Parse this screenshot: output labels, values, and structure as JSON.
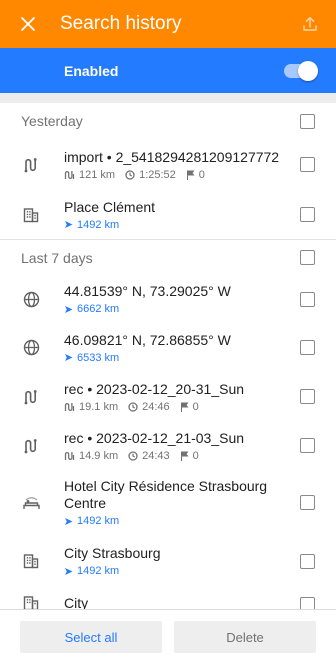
{
  "header": {
    "title": "Search history",
    "close_icon": "close-icon",
    "share_icon": "share-icon",
    "bg_color": "#ff8800"
  },
  "enabled_bar": {
    "label": "Enabled",
    "toggle_on": true,
    "bg_color": "#237bff"
  },
  "sections": {
    "yesterday": {
      "title": "Yesterday",
      "items": [
        {
          "icon": "route-icon",
          "name": "import • 2_5418294281209127772",
          "distance": "121 km",
          "duration": "1:25:52",
          "waypoints": "0"
        },
        {
          "icon": "building-icon",
          "name": "Place Clément",
          "distance": "1492 km"
        }
      ]
    },
    "last7": {
      "title": "Last 7 days",
      "items": [
        {
          "icon": "globe-icon",
          "name": "44.81539° N, 73.29025° W",
          "distance": "6662 km"
        },
        {
          "icon": "globe-icon",
          "name": "46.09821° N, 72.86855° W",
          "distance": "6533 km"
        },
        {
          "icon": "route-icon",
          "name": "rec • 2023-02-12_20-31_Sun",
          "distance": "19.1 km",
          "duration": "24:46",
          "waypoints": "0"
        },
        {
          "icon": "route-icon",
          "name": "rec • 2023-02-12_21-03_Sun",
          "distance": "14.9 km",
          "duration": "24:43",
          "waypoints": "0"
        },
        {
          "icon": "hotel-icon",
          "name": "Hotel City Résidence Strasbourg Centre",
          "distance": "1492 km"
        },
        {
          "icon": "building-icon",
          "name": "City Strasbourg",
          "distance": "1492 km"
        },
        {
          "icon": "building-icon",
          "name": "City"
        }
      ]
    }
  },
  "footer": {
    "select_all": "Select all",
    "delete": "Delete"
  },
  "colors": {
    "accent_blue": "#237bff",
    "muted_text": "#727272",
    "icon_gray": "#616161"
  }
}
